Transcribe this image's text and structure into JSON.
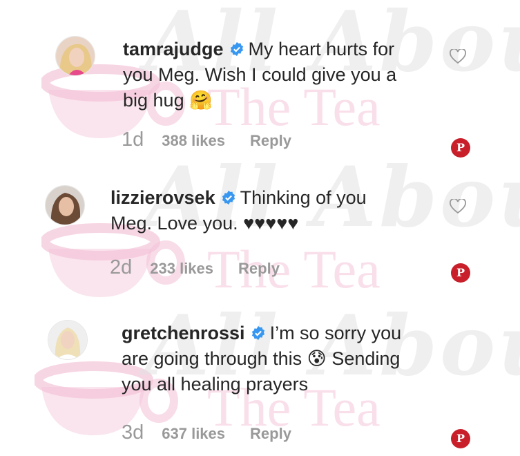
{
  "watermark": {
    "script_text": "All About",
    "tea_text": "The Tea",
    "color_pink": "#f4c4d8",
    "color_gray": "#e1e1e1"
  },
  "comments": [
    {
      "username": "tamrajudge",
      "text_line1": "My heart hurts for",
      "text_line2": "you Meg. Wish I could give you a",
      "text_line3": "big hug 🤗",
      "time": "1d",
      "likes": "388 likes",
      "reply": "Reply"
    },
    {
      "username": "lizzierovsek",
      "text_line1": "Thinking of you",
      "text_line2": "Meg. Love you. ♥♥♥♥♥",
      "time": "2d",
      "likes": "233 likes",
      "reply": "Reply"
    },
    {
      "username": "gretchenrossi",
      "text_line1": "I’m so sorry you",
      "text_line2": "are going through this 😰 Sending",
      "text_line3": "you all healing prayers",
      "time": "3d",
      "likes": "637 likes",
      "reply": "Reply"
    }
  ],
  "icons": {
    "verified_color": "#3897f0",
    "pinterest_color": "#c91f2a",
    "pin_glyph": "P"
  }
}
